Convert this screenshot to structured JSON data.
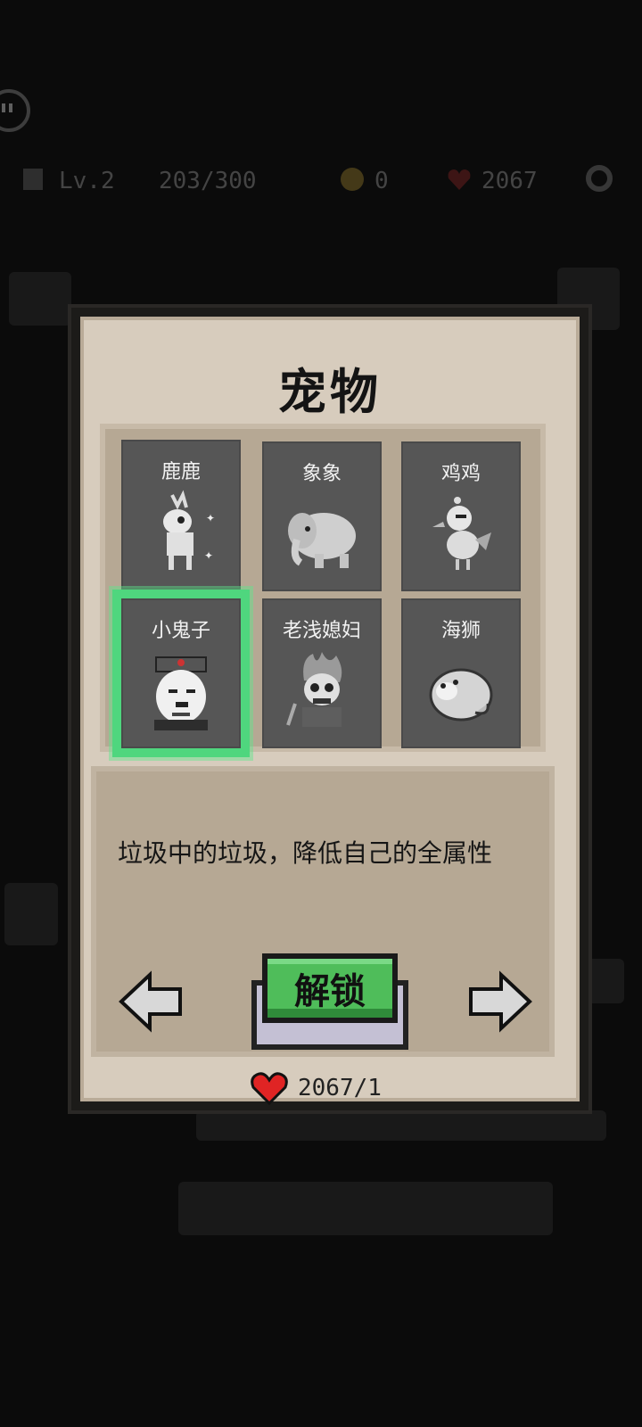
{
  "hud": {
    "level": "Lv.2",
    "exp": "203/300",
    "coins": "0",
    "hearts": "2067"
  },
  "modal": {
    "title": "宠物",
    "pets": [
      {
        "name": "鹿鹿",
        "icon": "deer-icon"
      },
      {
        "name": "象象",
        "icon": "elephant-icon"
      },
      {
        "name": "鸡鸡",
        "icon": "chicken-icon"
      },
      {
        "name": "小鬼子",
        "icon": "soldier-meme-icon"
      },
      {
        "name": "老浅媳妇",
        "icon": "flaming-skull-icon"
      },
      {
        "name": "海狮",
        "icon": "sea-lion-icon"
      }
    ],
    "selected_index": 3,
    "description": "垃圾中的垃圾，降低自己的全属性",
    "unlock_label": "解锁",
    "cost": "2067/1"
  },
  "colors": {
    "panel": "#d7ccbd",
    "inner_panel": "#b6a894",
    "select_green": "#4fd67e",
    "button_green": "#4fbd5a",
    "heart_red": "#e02424"
  }
}
